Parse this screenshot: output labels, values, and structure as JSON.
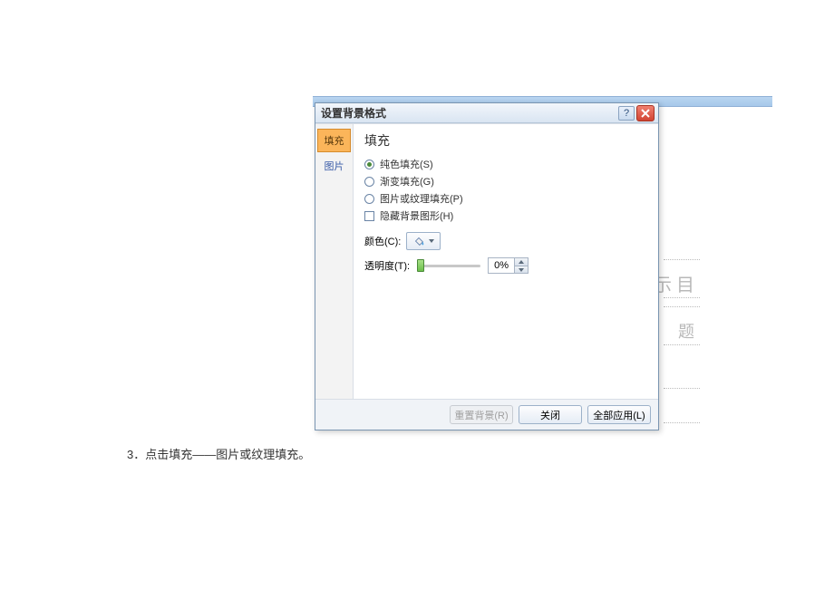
{
  "dialog": {
    "title": "设置背景格式",
    "help_label": "?",
    "tabs": [
      {
        "label": "填充",
        "active": true
      },
      {
        "label": "图片",
        "active": false
      }
    ],
    "panel_title": "填充",
    "options": {
      "solid": "纯色填充(S)",
      "gradient": "渐变填充(G)",
      "picture": "图片或纹理填充(P)",
      "hide_bg": "隐藏背景图形(H)"
    },
    "color_label": "颜色(C):",
    "transparency_label": "透明度(T):",
    "transparency_value": "0%",
    "buttons": {
      "reset": "重置背景(R)",
      "close": "关闭",
      "apply_all": "全部应用(L)"
    }
  },
  "doc_step": "3．点击填充——图片或纹理填充。",
  "bg_fragments": {
    "a": "示 目",
    "b": "题"
  }
}
